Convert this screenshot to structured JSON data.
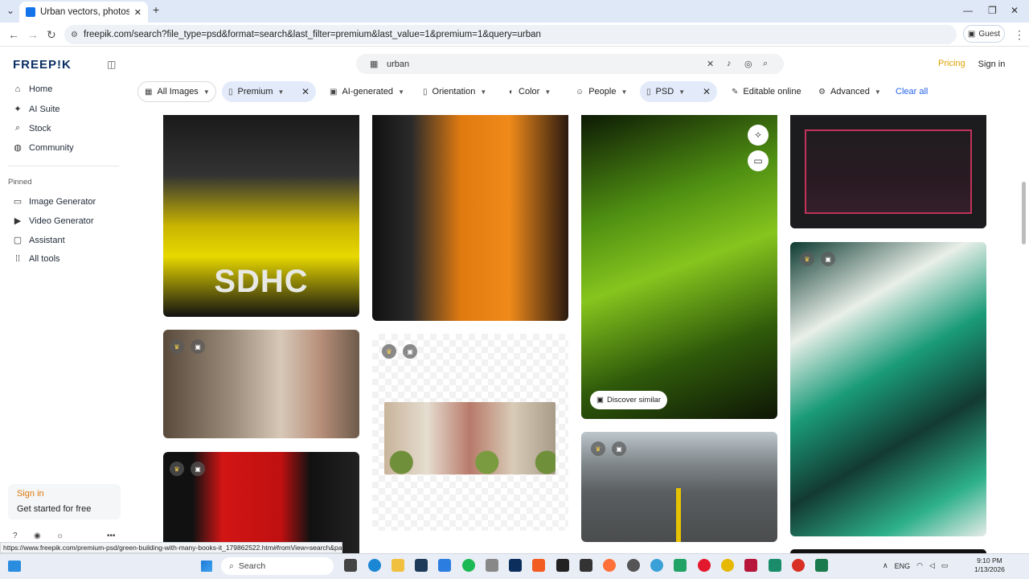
{
  "browser": {
    "tab_title": "Urban vectors, photos and PSD",
    "url": "freepik.com/search?file_type=psd&format=search&last_filter=premium&last_value=1&premium=1&query=urban",
    "guest_label": "Guest",
    "status_url": "https://www.freepik.com/premium-psd/green-building-with-many-books-it_179862522.htm#fromView=search&pag..."
  },
  "sidebar": {
    "logo": "FREEP!K",
    "items": [
      {
        "label": "Home",
        "icon": "home-icon"
      },
      {
        "label": "AI Suite",
        "icon": "sparkle-icon"
      },
      {
        "label": "Stock",
        "icon": "search-icon"
      },
      {
        "label": "Community",
        "icon": "globe-icon"
      }
    ],
    "pinned_label": "Pinned",
    "pinned": [
      {
        "label": "Image Generator",
        "icon": "image-icon"
      },
      {
        "label": "Video Generator",
        "icon": "video-icon"
      },
      {
        "label": "Assistant",
        "icon": "chat-icon"
      },
      {
        "label": "All tools",
        "icon": "grid-icon"
      }
    ],
    "signin_title": "Sign in",
    "signin_sub": "Get started for free"
  },
  "header": {
    "search_value": "urban",
    "pricing": "Pricing",
    "signin": "Sign in"
  },
  "filters": {
    "all_images": "All Images",
    "premium": "Premium",
    "ai_generated": "AI-generated",
    "orientation": "Orientation",
    "color": "Color",
    "people": "People",
    "psd": "PSD",
    "editable_online": "Editable online",
    "advanced": "Advanced",
    "clear_all": "Clear all"
  },
  "results": {
    "tile1_text": "SDHC",
    "discover_similar": "Discover similar"
  },
  "taskbar": {
    "search": "Search",
    "lang": "ENG",
    "time": "9:10 PM",
    "date": "1/13/2026"
  },
  "colors": {
    "accent": "#1273eb",
    "pricing": "#e0a200",
    "link": "#2563eb"
  }
}
